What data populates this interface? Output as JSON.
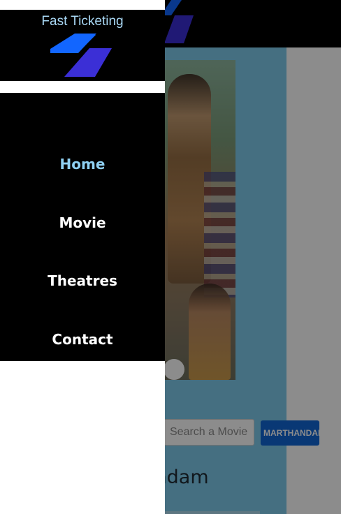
{
  "brand": {
    "name": "Fast Ticketing",
    "logo_icon": "parallelogram-logo-icon",
    "logo_colors": [
      "#1266ff",
      "#3b2fd6"
    ]
  },
  "nav": {
    "items": [
      {
        "label": "Home",
        "active": true
      },
      {
        "label": "Movie",
        "active": false
      },
      {
        "label": "Theatres",
        "active": false
      },
      {
        "label": "Contact",
        "active": false
      }
    ]
  },
  "search": {
    "placeholder": "Search a Movie",
    "location_label": "MARTHANDAM"
  },
  "main": {
    "section_heading": "andam"
  },
  "colors": {
    "active_nav": "#8fd0f2",
    "brand_text": "#a9d8f5",
    "page_background": "#7fcbeb",
    "location_button": "#1266d6"
  }
}
